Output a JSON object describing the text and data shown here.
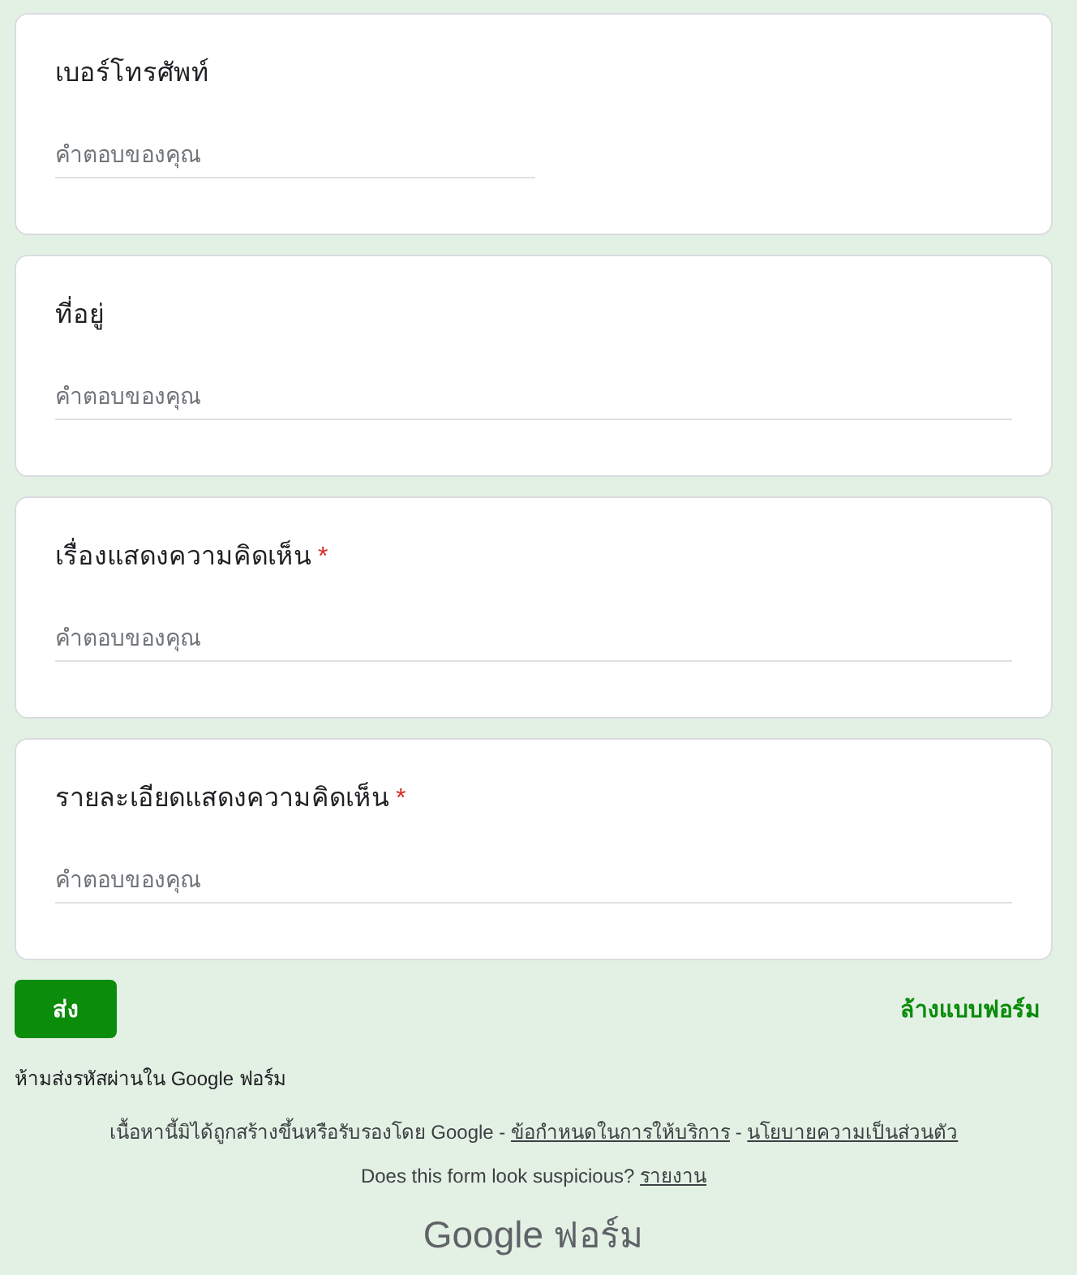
{
  "questions": [
    {
      "title": "เบอร์โทรศัพท์",
      "kind": "short",
      "placeholder": "คำตอบของคุณ"
    },
    {
      "title": "ที่อยู่",
      "kind": "long",
      "placeholder": "คำตอบของคุณ"
    },
    {
      "title": "เรื่องแสดงความคิดเห็น",
      "required_mark": "*",
      "kind": "long",
      "placeholder": "คำตอบของคุณ"
    },
    {
      "title": "รายละเอียดแสดงความคิดเห็น",
      "required_mark": "*",
      "kind": "long",
      "placeholder": "คำตอบของคุณ"
    }
  ],
  "submit_button": "ส่ง",
  "clear_form": "ล้างแบบฟอร์ม",
  "password_warning": "ห้ามส่งรหัสผ่านใน Google ฟอร์ม",
  "disclaimer": [
    {
      "kind": "text",
      "text": "เนื้อหานี้มิได้ถูกสร้างขึ้นหรือรับรองโดย Google - "
    },
    {
      "kind": "link",
      "text": "ข้อกำหนดในการให้บริการ"
    },
    {
      "kind": "text",
      "text": " - "
    },
    {
      "kind": "link",
      "text": "นโยบายความเป็นส่วนตัว"
    }
  ],
  "report_line": [
    {
      "kind": "text",
      "text": "Does this form look suspicious? "
    },
    {
      "kind": "link",
      "text": "รายงาน"
    }
  ],
  "logo": {
    "brand": "Google",
    "product": "ฟอร์ม"
  }
}
